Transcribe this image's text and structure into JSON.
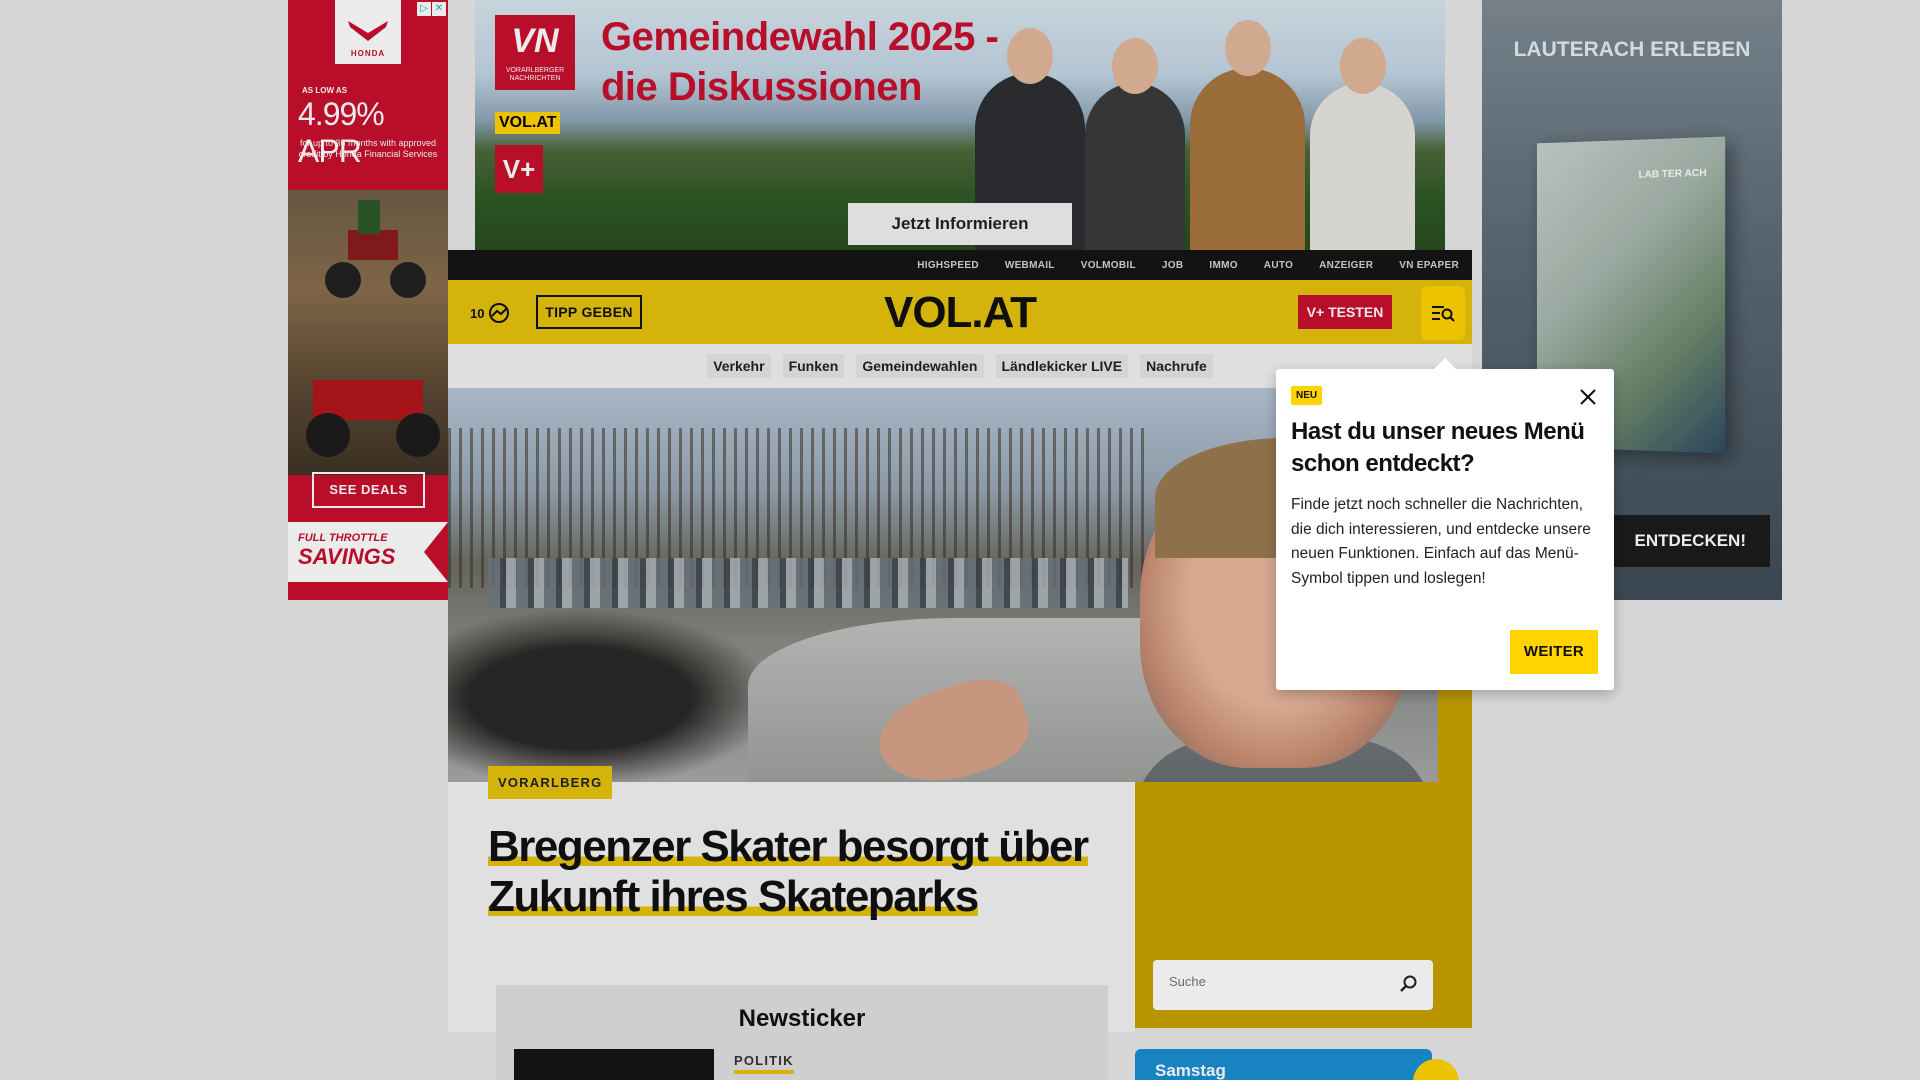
{
  "ad_left": {
    "brand": "HONDA",
    "apr_prefix": "AS LOW AS",
    "apr_value": "4.99% APR",
    "apr_note": "for up to 36 months with approved credit by Honda Financial Services",
    "cta": "SEE DEALS",
    "tagline_top": "FULL THROTTLE",
    "tagline_bottom": "SAVINGS",
    "adchoices_icons": [
      "adchoices-icon",
      "close-icon"
    ]
  },
  "banner": {
    "vn_logo": "VN",
    "vn_sub": "VORARLBERGER NACHRICHTEN",
    "vol_badge": "VOL.AT",
    "vplus_badge": "V+",
    "title_line1": "Gemeindewahl 2025 -",
    "title_line2": "die Diskussionen",
    "cta": "Jetzt Informieren"
  },
  "ad_right": {
    "title": "LAUTERACH ERLEBEN",
    "book_text": "LAB TER ACH",
    "cta": "ENTDECKEN!"
  },
  "topbar": {
    "links": [
      "HIGHSPEED",
      "WEBMAIL",
      "VOLMOBIL",
      "JOB",
      "IMMO",
      "AUTO",
      "ANZEIGER",
      "VN EPAPER"
    ]
  },
  "header": {
    "weather_temp": "10",
    "tipp_label": "TIPP GEBEN",
    "brand": "VOL.AT",
    "vtesten_label": "V+ TESTEN"
  },
  "subnav": {
    "items": [
      "Verkehr",
      "Funken",
      "Gemeindewahlen",
      "Ländlekicker LIVE",
      "Nachrufe"
    ]
  },
  "article": {
    "kicker": "VORARLBERG",
    "headline_line1": "Bregenzer Skater besorgt über",
    "headline_line2": "Zukunft ihres Skateparks"
  },
  "search": {
    "placeholder": "Suche"
  },
  "newsticker": {
    "title": "Newsticker",
    "first_category": "POLITIK"
  },
  "weather_card": {
    "day": "Samstag"
  },
  "popup": {
    "badge": "NEU",
    "title": "Hast du unser neues Menü schon entdeckt?",
    "body": "Finde jetzt noch schneller die Nachrichten, die dich interessieren, und entdecke unsere neuen Funktionen. Einfach auf das Menü-Symbol tippen und loslegen!",
    "button": "WEITER"
  },
  "colors": {
    "brand_yellow": "#e6c40d",
    "accent_yellow": "#ffd400",
    "vplus_red": "#c8102e",
    "topbar_black": "#151515"
  }
}
